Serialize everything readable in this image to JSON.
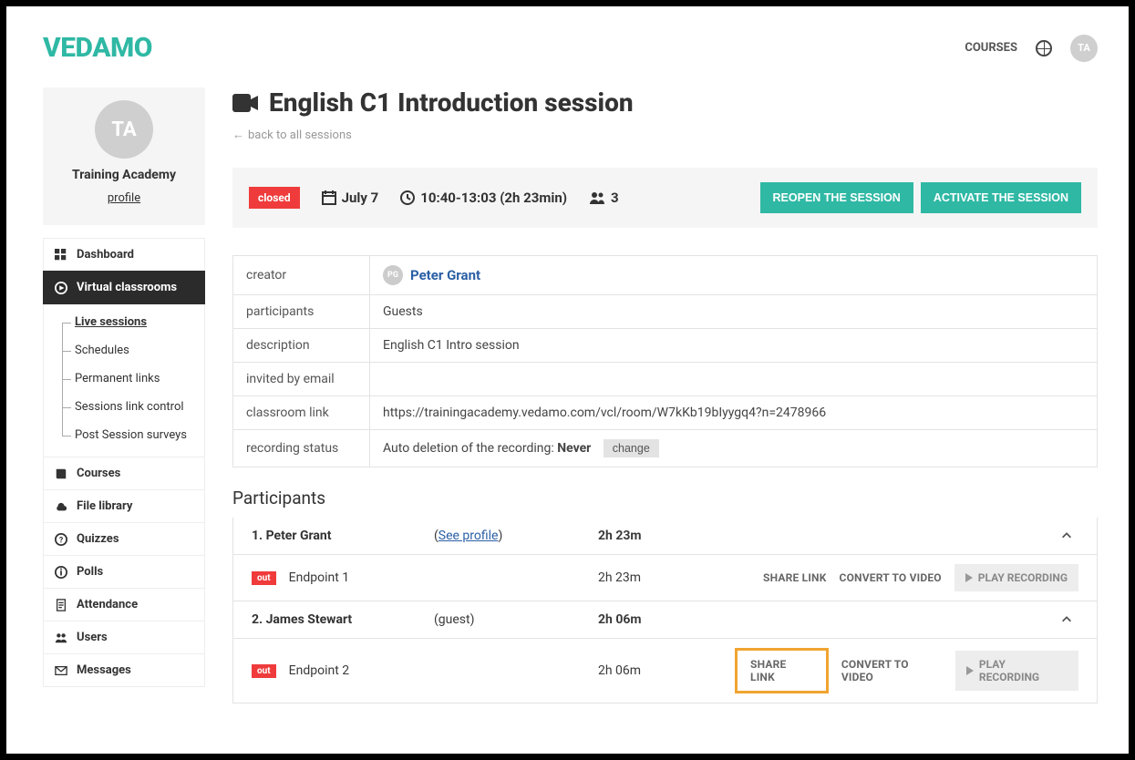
{
  "brand": "VEDAMO",
  "topnav": {
    "courses": "COURSES",
    "avatar": "TA"
  },
  "profile": {
    "avatar": "TA",
    "name": "Training Academy",
    "link": "profile"
  },
  "menu": {
    "dashboard": "Dashboard",
    "vclass": "Virtual classrooms",
    "sub": {
      "live": "Live sessions",
      "sched": "Schedules",
      "perm": "Permanent links",
      "slc": "Sessions link control",
      "pss": "Post Session surveys"
    },
    "courses": "Courses",
    "files": "File library",
    "quizzes": "Quizzes",
    "polls": "Polls",
    "attend": "Attendance",
    "users": "Users",
    "messages": "Messages"
  },
  "page": {
    "title": "English C1 Introduction session",
    "back": "back to all sessions"
  },
  "status": {
    "badge": "closed",
    "date": "July 7",
    "time": "10:40-13:03 (2h 23min)",
    "count": "3",
    "reopen": "REOPEN THE SESSION",
    "activate": "ACTIVATE THE SESSION"
  },
  "info": {
    "creator_lbl": "creator",
    "creator_name": "Peter Grant",
    "creator_initials": "PG",
    "participants_lbl": "participants",
    "participants_val": "Guests",
    "desc_lbl": "description",
    "desc_val": "English C1 Intro session",
    "invited_lbl": "invited by email",
    "invited_val": "",
    "link_lbl": "classroom link",
    "link_val": "https://trainingacademy.vedamo.com/vcl/room/W7kKb19bIyygq4?n=2478966",
    "rec_lbl": "recording status",
    "rec_val_prefix": "Auto deletion of the recording: ",
    "rec_val_bold": "Never",
    "rec_change": "change"
  },
  "participants_heading": "Participants",
  "participants": [
    {
      "num": "1.",
      "name": "Peter Grant",
      "extra": "See profile",
      "extra_paren": [
        "(",
        ")"
      ],
      "dur": "2h 23m",
      "ep": {
        "badge": "out",
        "name": "Endpoint 1",
        "dur": "2h 23m"
      }
    },
    {
      "num": "2.",
      "name": "James Stewart",
      "extra": "(guest)",
      "dur": "2h 06m",
      "ep": {
        "badge": "out",
        "name": "Endpoint 2",
        "dur": "2h 06m"
      }
    }
  ],
  "actions": {
    "share": "SHARE LINK",
    "convert": "CONVERT TO VIDEO",
    "play": "PLAY RECORDING"
  }
}
